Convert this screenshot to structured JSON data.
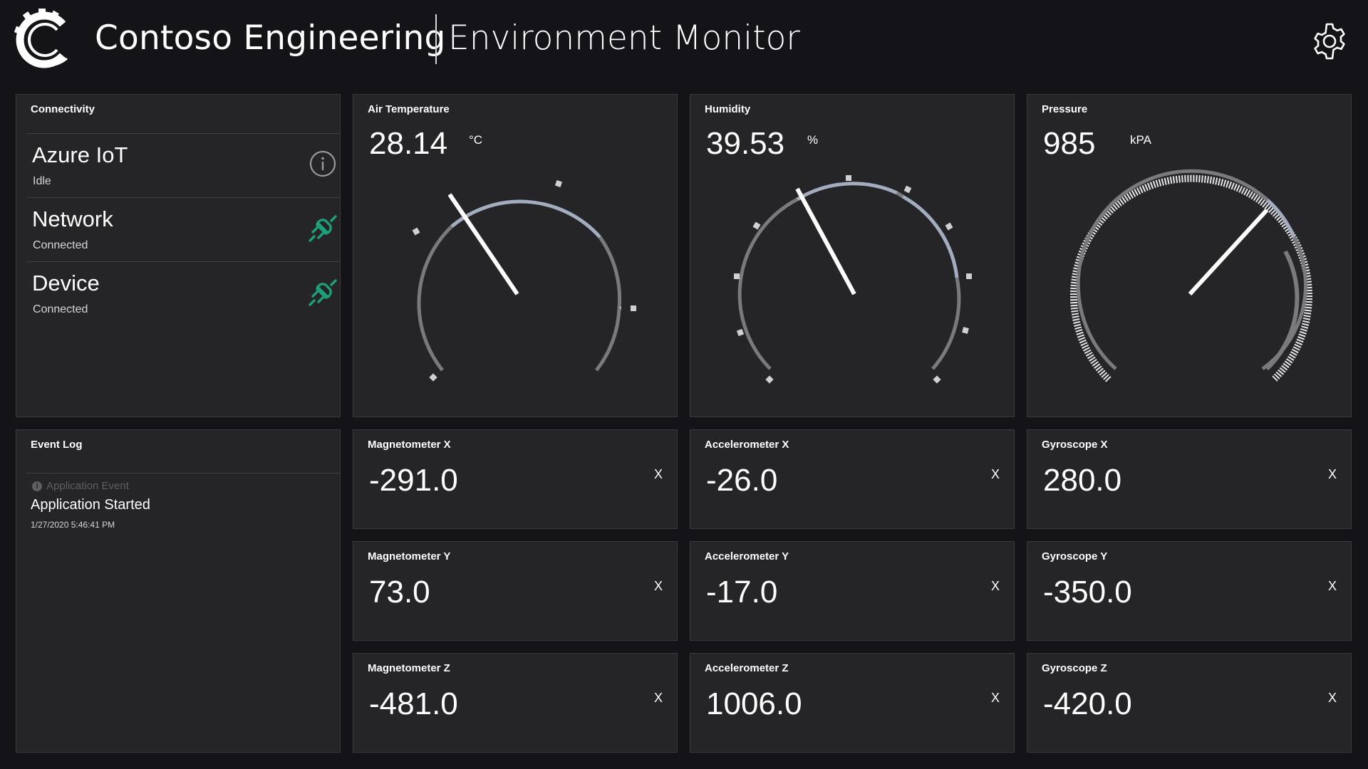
{
  "header": {
    "company": "Contoso Engineering",
    "title": "Environment Monitor",
    "logo_icon": "contoso-gear-c-logo",
    "settings_icon": "gear-icon"
  },
  "connectivity": {
    "title": "Connectivity",
    "items": [
      {
        "name": "Azure IoT",
        "status": "Idle",
        "icon": "info-icon"
      },
      {
        "name": "Network",
        "status": "Connected",
        "icon": "plug-icon"
      },
      {
        "name": "Device",
        "status": "Connected",
        "icon": "plug-icon"
      }
    ]
  },
  "event_log": {
    "title": "Event Log",
    "entries": [
      {
        "category": "Application Event",
        "message": "Application Started",
        "timestamp": "1/27/2020 5:46:41 PM"
      }
    ]
  },
  "gauges": {
    "air_temperature": {
      "label": "Air Temperature",
      "value": "28.14",
      "unit": "°C"
    },
    "humidity": {
      "label": "Humidity",
      "value": "39.53",
      "unit": "%"
    },
    "pressure": {
      "label": "Pressure",
      "value": "985",
      "unit": "kPA"
    }
  },
  "sensors": {
    "magnetometer": [
      {
        "label": "Magnetometer X",
        "value": "-291.0",
        "unit": "X"
      },
      {
        "label": "Magnetometer Y",
        "value": "73.0",
        "unit": "X"
      },
      {
        "label": "Magnetometer Z",
        "value": "-481.0",
        "unit": "X"
      }
    ],
    "accelerometer": [
      {
        "label": "Accelerometer X",
        "value": "-26.0",
        "unit": "X"
      },
      {
        "label": "Accelerometer Y",
        "value": "-17.0",
        "unit": "X"
      },
      {
        "label": "Accelerometer Z",
        "value": "1006.0",
        "unit": "X"
      }
    ],
    "gyroscope": [
      {
        "label": "Gyroscope X",
        "value": "280.0",
        "unit": "X"
      },
      {
        "label": "Gyroscope Y",
        "value": "-350.0",
        "unit": "X"
      },
      {
        "label": "Gyroscope Z",
        "value": "-420.0",
        "unit": "X"
      }
    ]
  },
  "colors": {
    "background": "#131318",
    "panel": "#252527",
    "accent_connected": "#1f9e7a",
    "gauge_scale": "#7a7a7e",
    "gauge_highlight": "#a3adbf",
    "needle": "#ffffff"
  }
}
